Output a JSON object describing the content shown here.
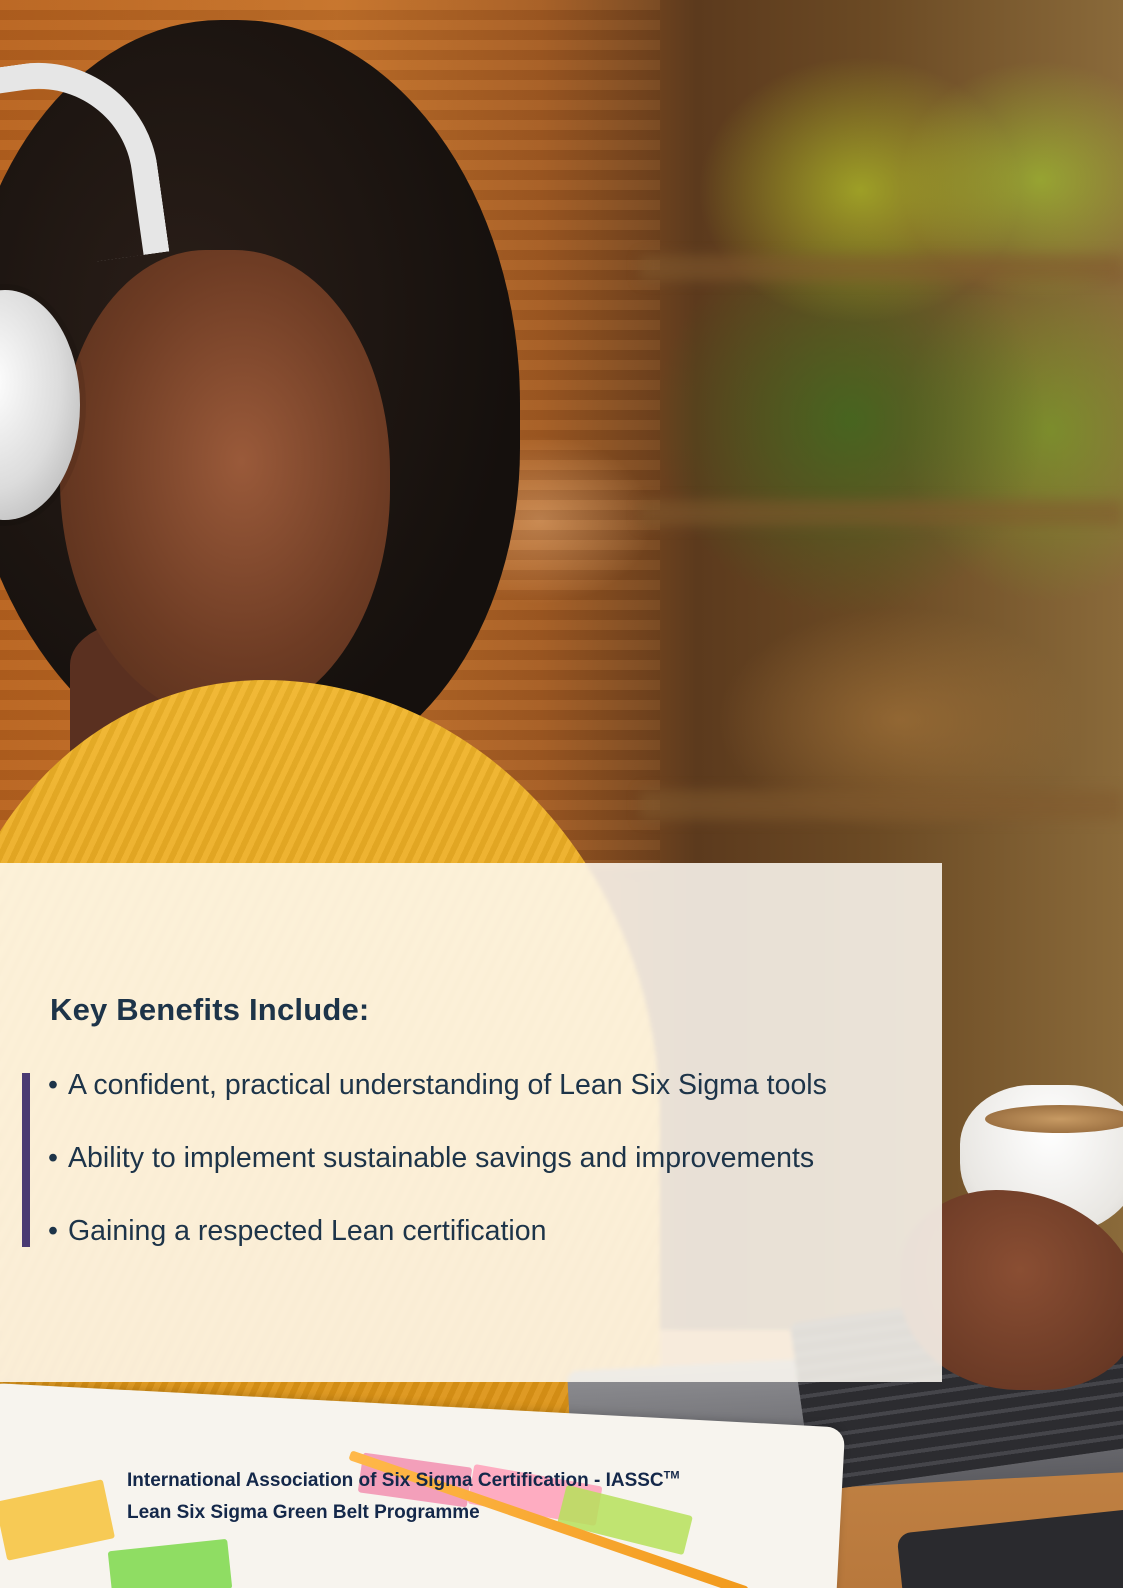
{
  "panel": {
    "title": "Key Benefits Include:",
    "benefits": [
      {
        "bullet": "•",
        "text": "A confident, practical understanding of Lean Six Sigma tools"
      },
      {
        "bullet": "•",
        "text": "Ability to implement sustainable savings and improvements"
      },
      {
        "bullet": "•",
        "text": "Gaining a respected Lean certification"
      }
    ]
  },
  "footer": {
    "organization": "International Association of Six Sigma Certification - IASSC",
    "trademark": "TM",
    "programme": "Lean Six Sigma Green Belt Programme"
  },
  "colors": {
    "heading_text": "#1d3449",
    "accent_bar": "#4a3a72",
    "footer_text": "#14284a",
    "panel_background": "#fffcf5"
  }
}
